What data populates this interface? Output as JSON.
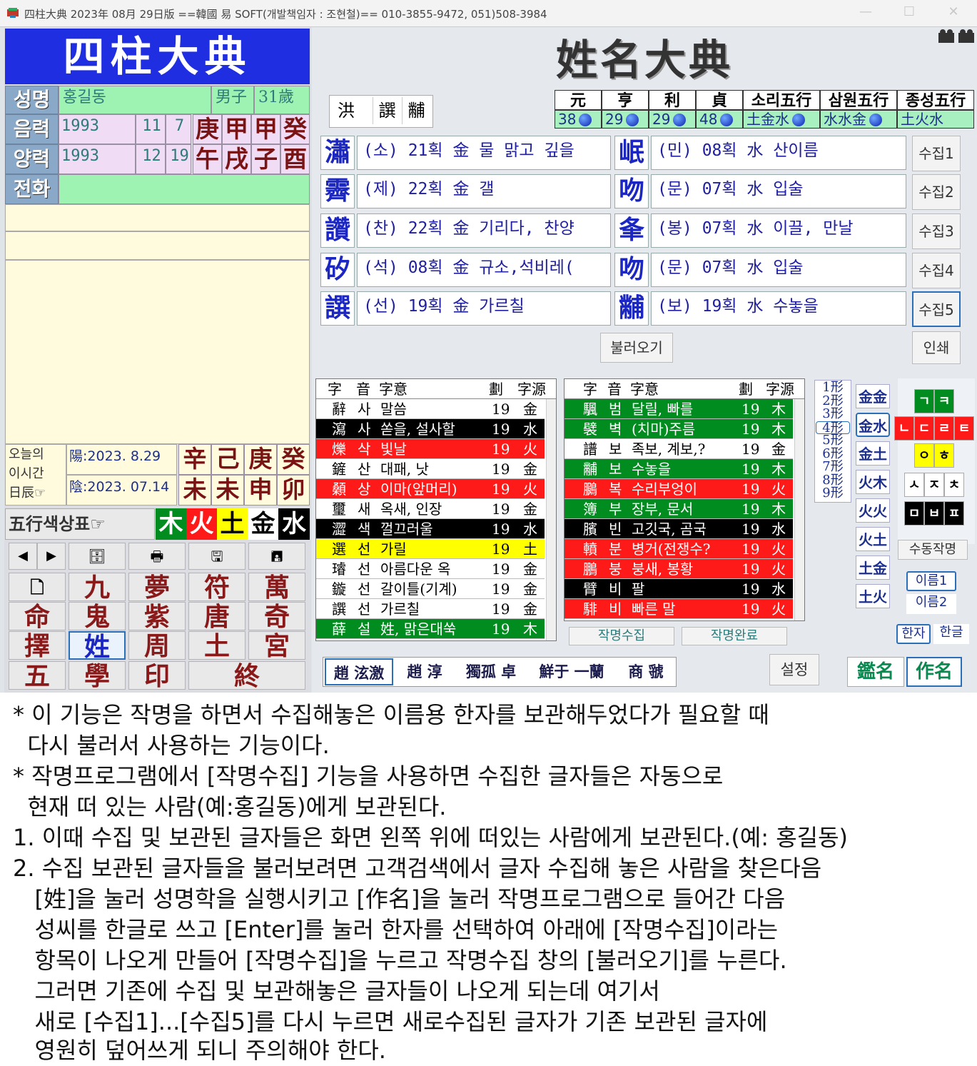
{
  "window": {
    "title": "四柱大典 2023年 08月 29日版 ==韓國 易 SOFT(개발책임자 : 조현철)== 010-3855-9472, 051)508-3984",
    "controls": [
      "—",
      "☐",
      "✕"
    ]
  },
  "left": {
    "banner": "四柱大典",
    "labels": {
      "name": "성명",
      "lunar": "음력",
      "solar": "양력",
      "phone": "전화"
    },
    "name_value": "홍길동",
    "sex": "男子",
    "age": "31歲",
    "lunar": {
      "year": "1993",
      "month": "11",
      "day": "7",
      "pillars": [
        "庚",
        "甲",
        "甲",
        "癸"
      ]
    },
    "solar": {
      "year": "1993",
      "month": "12",
      "day": "19",
      "pillars": [
        "午",
        "戌",
        "子",
        "酉"
      ]
    },
    "today": {
      "label": [
        "오늘의",
        "이시간",
        "日辰☞"
      ],
      "solar_date": "陽:2023.  8.29",
      "lunar_date": "陰:2023.  07.14",
      "stems": [
        "辛",
        "己",
        "庚",
        "癸"
      ],
      "branches": [
        "未",
        "未",
        "申",
        "卯"
      ]
    },
    "ohaeng": {
      "label": "五行색상표☞",
      "items": [
        "木",
        "火",
        "土",
        "金",
        "水"
      ]
    },
    "nav_buttons": [
      "◀",
      "▶",
      "🗄",
      "🖶",
      "🖫",
      "🖪"
    ],
    "grid": [
      [
        "🗋",
        "九",
        "夢",
        "符",
        "萬"
      ],
      [
        "命",
        "鬼",
        "紫",
        "唐",
        "奇"
      ],
      [
        "擇",
        "姓",
        "周",
        "土",
        "宮"
      ],
      [
        "五",
        "學",
        "印",
        "終"
      ]
    ]
  },
  "right": {
    "banner": "姓名大典",
    "surname_buttons": [
      "洪",
      "譔",
      "黼"
    ],
    "elements": {
      "headers": [
        "元",
        "亨",
        "利",
        "貞",
        "소리五行",
        "삼원五行",
        "종성五行"
      ],
      "values": [
        "38",
        "29",
        "29",
        "48",
        "土金水",
        "水水金",
        "土火水"
      ]
    },
    "rows": [
      {
        "h1": "瀟",
        "d1": "(소) 21획 金 물 맑고 깊을",
        "h2": "岷",
        "d2": "(민) 08획 水 산이름",
        "btn": "수집1"
      },
      {
        "h1": "霽",
        "d1": "(제) 22획 金 갤",
        "h2": "吻",
        "d2": "(문) 07획 水 입술",
        "btn": "수집2"
      },
      {
        "h1": "讚",
        "d1": "(찬) 22획 金 기리다, 찬양",
        "h2": "夆",
        "d2": "(봉) 07획 水 이끌, 만날",
        "btn": "수집3"
      },
      {
        "h1": "矽",
        "d1": "(석) 08획 金 규소,석비레(",
        "h2": "吻",
        "d2": "(문) 07획 水 입술",
        "btn": "수집4"
      },
      {
        "h1": "譔",
        "d1": "(선) 19획 金 가르칠",
        "h2": "黼",
        "d2": "(보) 19획 水 수놓을",
        "btn": "수집5"
      }
    ],
    "load_button": "불러오기",
    "print_button": "인쇄",
    "table_headers": [
      "字",
      "音",
      "字意",
      "劃",
      "字源"
    ],
    "table1": [
      {
        "c": "辭",
        "e": "사",
        "m": "말씀",
        "s": "19",
        "o": "金",
        "bg": "#ffffff",
        "fg": "#000000"
      },
      {
        "c": "瀉",
        "e": "사",
        "m": "쏟을, 설사할",
        "s": "19",
        "o": "水",
        "bg": "#000000",
        "fg": "#ffffff"
      },
      {
        "c": "爍",
        "e": "삭",
        "m": "빛날",
        "s": "19",
        "o": "火",
        "bg": "#ff1a1a",
        "fg": "#ffffff"
      },
      {
        "c": "鏟",
        "e": "산",
        "m": "대패, 낫",
        "s": "19",
        "o": "金",
        "bg": "#ffffff",
        "fg": "#000000"
      },
      {
        "c": "顙",
        "e": "상",
        "m": "이마(앞머리)",
        "s": "19",
        "o": "火",
        "bg": "#ff1a1a",
        "fg": "#ffffff"
      },
      {
        "c": "璽",
        "e": "새",
        "m": "옥새, 인장",
        "s": "19",
        "o": "金",
        "bg": "#ffffff",
        "fg": "#000000"
      },
      {
        "c": "澀",
        "e": "색",
        "m": "껄끄러울",
        "s": "19",
        "o": "水",
        "bg": "#000000",
        "fg": "#ffffff"
      },
      {
        "c": "選",
        "e": "선",
        "m": "가릴",
        "s": "19",
        "o": "土",
        "bg": "#ffff00",
        "fg": "#000000"
      },
      {
        "c": "璿",
        "e": "선",
        "m": "아름다운 옥",
        "s": "19",
        "o": "金",
        "bg": "#ffffff",
        "fg": "#000000"
      },
      {
        "c": "鏇",
        "e": "선",
        "m": "갈이틀(기계)",
        "s": "19",
        "o": "金",
        "bg": "#ffffff",
        "fg": "#000000"
      },
      {
        "c": "譔",
        "e": "선",
        "m": "가르칠",
        "s": "19",
        "o": "金",
        "bg": "#ffffff",
        "fg": "#000000"
      },
      {
        "c": "薛",
        "e": "설",
        "m": "姓, 맑은대쑥",
        "s": "19",
        "o": "木",
        "bg": "#008c1e",
        "fg": "#ffffff"
      }
    ],
    "table2": [
      {
        "c": "颿",
        "e": "범",
        "m": "달릴, 빠를",
        "s": "19",
        "o": "木",
        "bg": "#008c1e",
        "fg": "#ffffff"
      },
      {
        "c": "襞",
        "e": "벽",
        "m": "(치마)주름",
        "s": "19",
        "o": "木",
        "bg": "#008c1e",
        "fg": "#ffffff"
      },
      {
        "c": "譜",
        "e": "보",
        "m": "족보, 계보,?",
        "s": "19",
        "o": "金",
        "bg": "#ffffff",
        "fg": "#000000"
      },
      {
        "c": "黼",
        "e": "보",
        "m": "수놓을",
        "s": "19",
        "o": "木",
        "bg": "#008c1e",
        "fg": "#ffffff"
      },
      {
        "c": "鵩",
        "e": "복",
        "m": "수리부엉이",
        "s": "19",
        "o": "火",
        "bg": "#ff1a1a",
        "fg": "#ffffff"
      },
      {
        "c": "簿",
        "e": "부",
        "m": "장부, 문서",
        "s": "19",
        "o": "木",
        "bg": "#008c1e",
        "fg": "#ffffff"
      },
      {
        "c": "臏",
        "e": "빈",
        "m": "고깃국, 곰국",
        "s": "19",
        "o": "水",
        "bg": "#000000",
        "fg": "#ffffff"
      },
      {
        "c": "轒",
        "e": "분",
        "m": "병거(전쟁수?",
        "s": "19",
        "o": "火",
        "bg": "#ff1a1a",
        "fg": "#ffffff"
      },
      {
        "c": "鵬",
        "e": "붕",
        "m": "붕새, 봉황",
        "s": "19",
        "o": "火",
        "bg": "#ff1a1a",
        "fg": "#ffffff"
      },
      {
        "c": "臂",
        "e": "비",
        "m": "팔",
        "s": "19",
        "o": "水",
        "bg": "#000000",
        "fg": "#ffffff"
      },
      {
        "c": "騑",
        "e": "비",
        "m": "빠른 말",
        "s": "19",
        "o": "火",
        "bg": "#ff1a1a",
        "fg": "#ffffff"
      }
    ],
    "jakmyeong_collect": "작명수집",
    "jakmyeong_done": "작명완료",
    "shapes": [
      "1形",
      "2形",
      "3形",
      "4形",
      "5形",
      "6形",
      "7形",
      "8形",
      "9形"
    ],
    "el_buttons": [
      "金金",
      "金水",
      "金土",
      "火木",
      "火火",
      "火土",
      "土金",
      "土火"
    ],
    "jamo": {
      "row1": [
        "ㄱ",
        "ㅋ"
      ],
      "row2": [
        "ㄴ",
        "ㄷ",
        "ㄹ",
        "ㅌ"
      ],
      "row3": [
        "ㅇ",
        "ㅎ"
      ],
      "row4": [
        "ㅅ",
        "ㅈ",
        "ㅊ"
      ],
      "row5": [
        "ㅁ",
        "ㅂ",
        "ㅍ"
      ]
    },
    "manual_name": "수동작명",
    "name1": "이름1",
    "name2": "이름2",
    "hanja_toggle": "한자",
    "hangul_toggle": "한글",
    "bottom_names": [
      "趙 泫激",
      "趙 淳",
      "獨孤 卓",
      "鮮于 一蘭",
      "商 虢"
    ],
    "settings": "설정",
    "gamming": "鑑名",
    "jakmyeong": "作名"
  },
  "notes": [
    "* 이 기능은 작명을 하면서 수집해놓은 이름용 한자를 보관해두었다가 필요할 때",
    "  다시 불러서 사용하는 기능이다.",
    "* 작명프로그램에서 [작명수집] 기능을 사용하면 수집한 글자들은 자동으로",
    "  현재 떠 있는 사람(예:홍길동)에게 보관된다.",
    "1. 이때 수집 및 보관된 글자들은 화면 왼쪽 위에 떠있는 사람에게 보관된다.(예: 홍길동)",
    "2. 수집 보관된 글자들을 불러보려면 고객검색에서 글자 수집해 놓은 사람을 찾은다음",
    "   [姓]을 눌러 성명학을 실행시키고 [作名]을 눌러 작명프로그램으로 들어간 다음",
    "   성씨를 한글로 쓰고 [Enter]를 눌러 한자를 선택하여 아래에 [작명수집]이라는",
    "   항목이 나오게 만들어 [작명수집]을 누르고 작명수집 창의 [불러오기]를 누른다.",
    "   그러면 기존에 수집 및 보관해놓은 글자들이 나오게 되는데 여기서",
    "   새로 [수집1]...[수집5]를 다시 누르면 새로수집된 글자가 기존 보관된 글자에",
    "   영원히 덮어쓰게 되니 주의해야 한다."
  ],
  "colors": {
    "wood": "#008c1e",
    "fire": "#ff1a1a",
    "earth": "#ffff00",
    "metal": "#ffffff",
    "water": "#000000"
  }
}
